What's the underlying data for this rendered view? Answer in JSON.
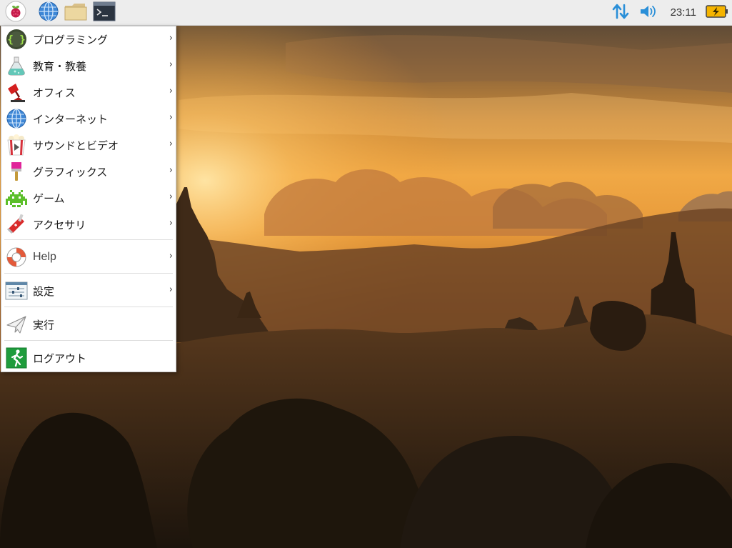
{
  "panel": {
    "launchers": [
      {
        "name": "raspberry-menu-icon"
      },
      {
        "name": "web-browser-icon"
      },
      {
        "name": "file-manager-icon"
      },
      {
        "name": "terminal-icon"
      }
    ],
    "clock": "23:11",
    "tray": [
      "network-transfer-icon",
      "volume-icon",
      "battery-charging-icon"
    ]
  },
  "menu": {
    "items": [
      {
        "label": "プログラミング",
        "icon": "programming-icon",
        "submenu": true
      },
      {
        "label": "教育・教養",
        "icon": "education-icon",
        "submenu": true
      },
      {
        "label": "オフィス",
        "icon": "office-icon",
        "submenu": true
      },
      {
        "label": "インターネット",
        "icon": "internet-icon",
        "submenu": true
      },
      {
        "label": "サウンドとビデオ",
        "icon": "sound-video-icon",
        "submenu": true
      },
      {
        "label": "グラフィックス",
        "icon": "graphics-icon",
        "submenu": true
      },
      {
        "label": "ゲーム",
        "icon": "games-icon",
        "submenu": true
      },
      {
        "label": "アクセサリ",
        "icon": "accessories-icon",
        "submenu": true
      },
      {
        "label": "Help",
        "icon": "help-icon",
        "submenu": true
      },
      {
        "label": "設定",
        "icon": "preferences-icon",
        "submenu": true
      },
      {
        "label": "実行",
        "icon": "run-icon",
        "submenu": false
      },
      {
        "label": "ログアウト",
        "icon": "logout-icon",
        "submenu": false
      }
    ],
    "arrow": "›"
  },
  "colors": {
    "accent_blue": "#2a8fd8",
    "panel_bg": "#ededed",
    "sky_top": "#5a4a3a",
    "sky_glow": "#f2a542"
  }
}
